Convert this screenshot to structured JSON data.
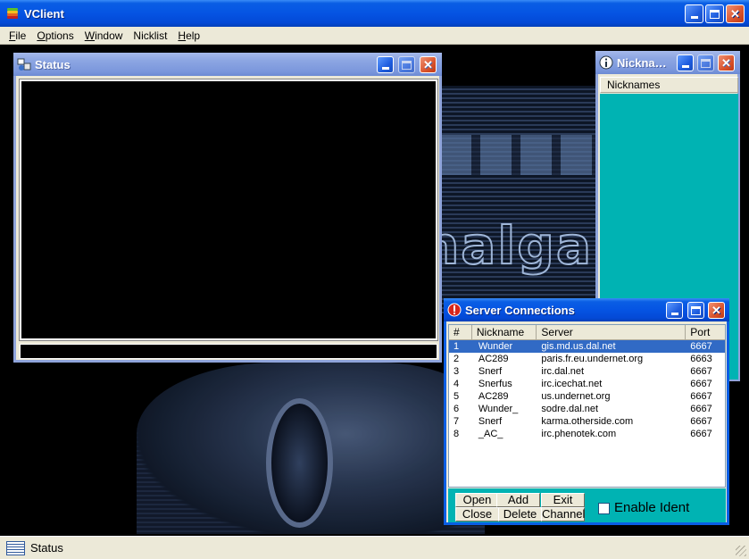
{
  "app": {
    "title": "VClient",
    "menu": [
      {
        "label": "File",
        "key": "F",
        "rest": "ile"
      },
      {
        "label": "Options",
        "key": "O",
        "rest": "ptions"
      },
      {
        "label": "Window",
        "key": "W",
        "rest": "indow"
      },
      {
        "label": "Nicklist",
        "key": "",
        "rest": "Nicklist"
      },
      {
        "label": "Help",
        "key": "H",
        "rest": "elp"
      }
    ]
  },
  "background": {
    "logo_text": "nalga"
  },
  "status_window": {
    "title": "Status",
    "input_value": ""
  },
  "nick_window": {
    "title": "Nickna…",
    "column_header": "Nicknames",
    "nicknames": []
  },
  "server_window": {
    "title": "Server Connections",
    "columns": {
      "num": "#",
      "nickname": "Nickname",
      "server": "Server",
      "port": "Port"
    },
    "rows": [
      {
        "num": "1",
        "nickname": "Wunder",
        "server": "gis.md.us.dal.net",
        "port": "6667",
        "selected": true
      },
      {
        "num": "2",
        "nickname": "AC289",
        "server": "paris.fr.eu.undernet.org",
        "port": "6663"
      },
      {
        "num": "3",
        "nickname": "Snerf",
        "server": "irc.dal.net",
        "port": "6667"
      },
      {
        "num": "4",
        "nickname": "Snerfus",
        "server": "irc.icechat.net",
        "port": "6667"
      },
      {
        "num": "5",
        "nickname": "AC289",
        "server": "us.undernet.org",
        "port": "6667"
      },
      {
        "num": "6",
        "nickname": "Wunder_",
        "server": "sodre.dal.net",
        "port": "6667"
      },
      {
        "num": "7",
        "nickname": "Snerf",
        "server": "karma.otherside.com",
        "port": "6667"
      },
      {
        "num": "8",
        "nickname": "_AC_",
        "server": "irc.phenotek.com",
        "port": "6667"
      }
    ],
    "buttons": {
      "open": "Open",
      "add": "Add",
      "exit": "Exit",
      "close": "Close",
      "delete": "Delete",
      "channel": "Channel"
    },
    "ident_label": "Enable Ident",
    "ident_checked": false
  },
  "statusbar": {
    "text": "Status"
  },
  "colors": {
    "accent": "#0554e3",
    "list_bg": "#00b3b3",
    "selection": "#316ac5"
  }
}
